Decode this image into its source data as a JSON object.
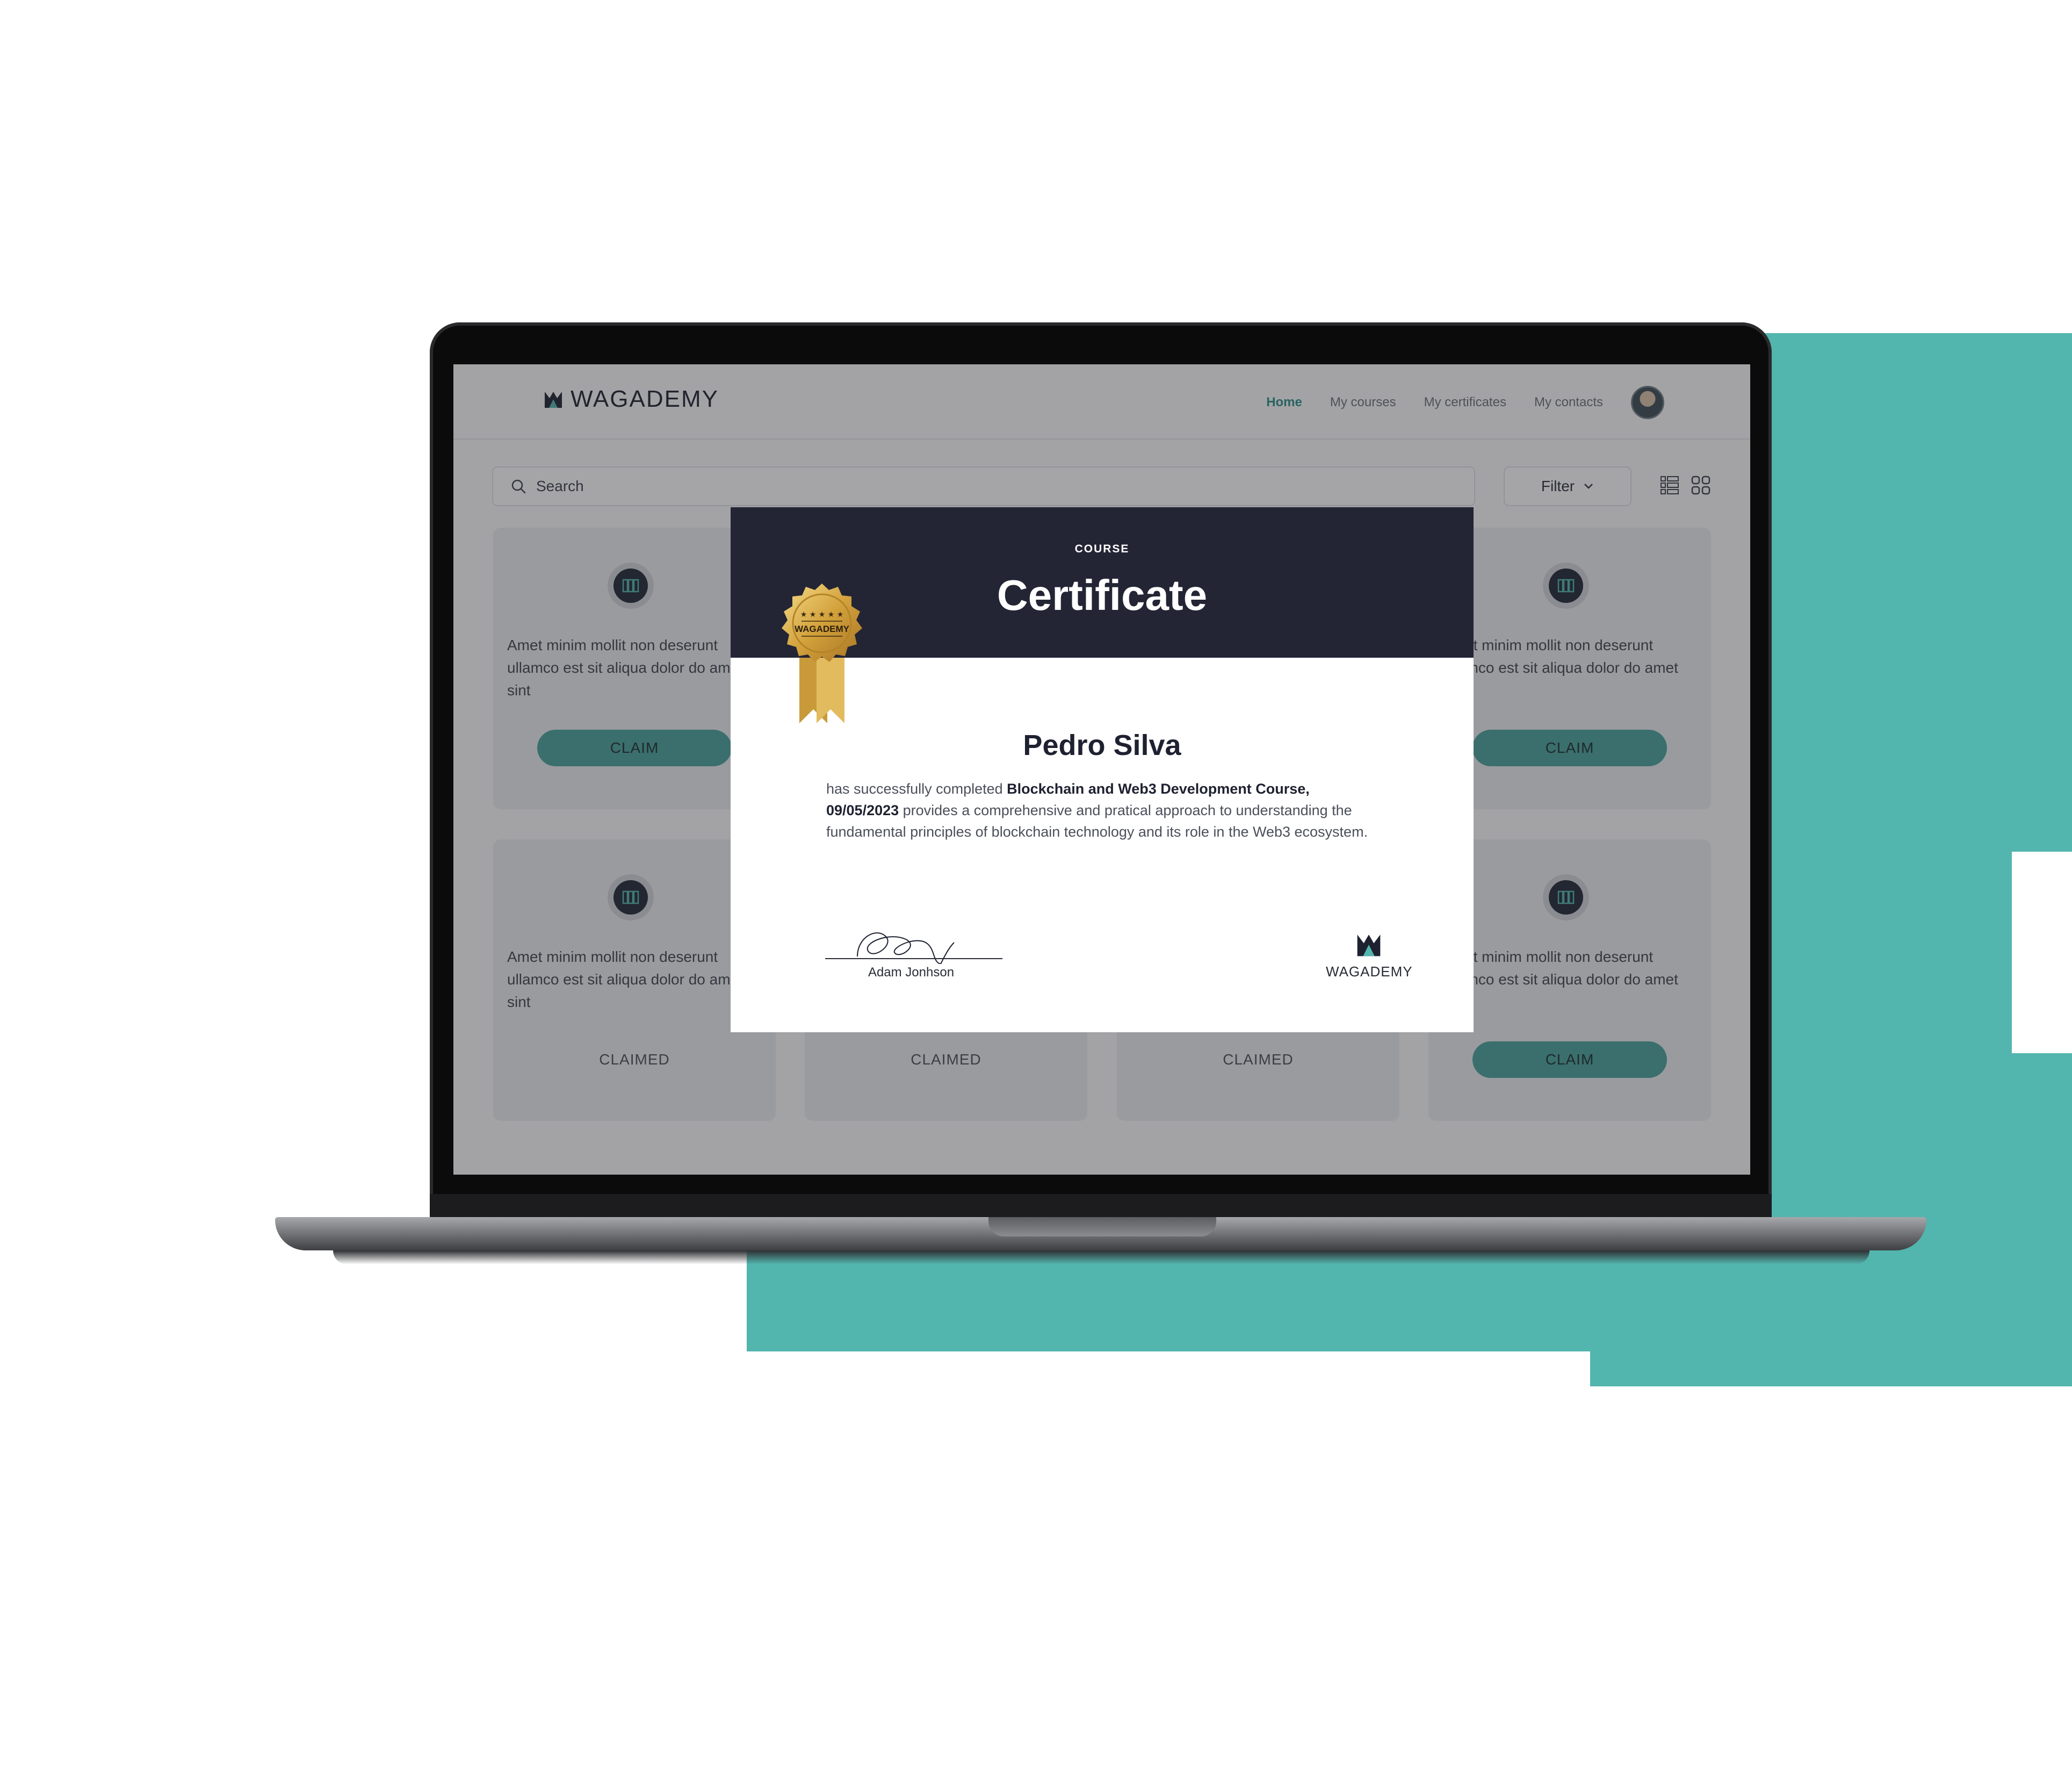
{
  "brand": {
    "name": "WAGADEMY",
    "accent": "#47a39c",
    "dark": "#232535"
  },
  "nav": {
    "items": [
      "Home",
      "My courses",
      "My certificates",
      "My contacts"
    ],
    "active": "Home"
  },
  "search": {
    "placeholder": "Search"
  },
  "filter": {
    "label": "Filter"
  },
  "cards": [
    {
      "text": "Amet minim mollit non deserunt ullamco est sit aliqua dolor do amet sint",
      "action": "CLAIM"
    },
    {
      "text": "Amet minim mollit non deserunt ullamco est sit aliqua dolor do amet sint",
      "action": "CLAIM"
    },
    {
      "text": "Amet minim mollit non deserunt ullamco est sit aliqua dolor do amet sint",
      "action": "CLAIMED"
    },
    {
      "text": "Amet minim mollit non deserunt ullamco est sit aliqua dolor do amet sint",
      "action": "CLAIMED"
    },
    {
      "text": "Amet minim mollit non deserunt ullamco est sit aliqua dolor do amet sint",
      "action": "CLAIMED"
    },
    {
      "text": "Amet minim mollit non deserunt ullamco est sit aliqua dolor do amet sint",
      "action": "CLAIM"
    }
  ],
  "certificate": {
    "kicker": "COURSE",
    "title": "Certificate",
    "recipient": "Pedro Silva",
    "body_prefix": "has successfully completed ",
    "course": "Blockchain and Web3 Development Course, 09/05/2023",
    "body_suffix": " provides a comprehensive and pratical approach to understanding the fundamental principles of blockchain technology and its role in the Web3 ecosystem.",
    "medal_label": "WAGADEMY",
    "signer": "Adam Jonhson",
    "logo_text": "WAGADEMY"
  }
}
